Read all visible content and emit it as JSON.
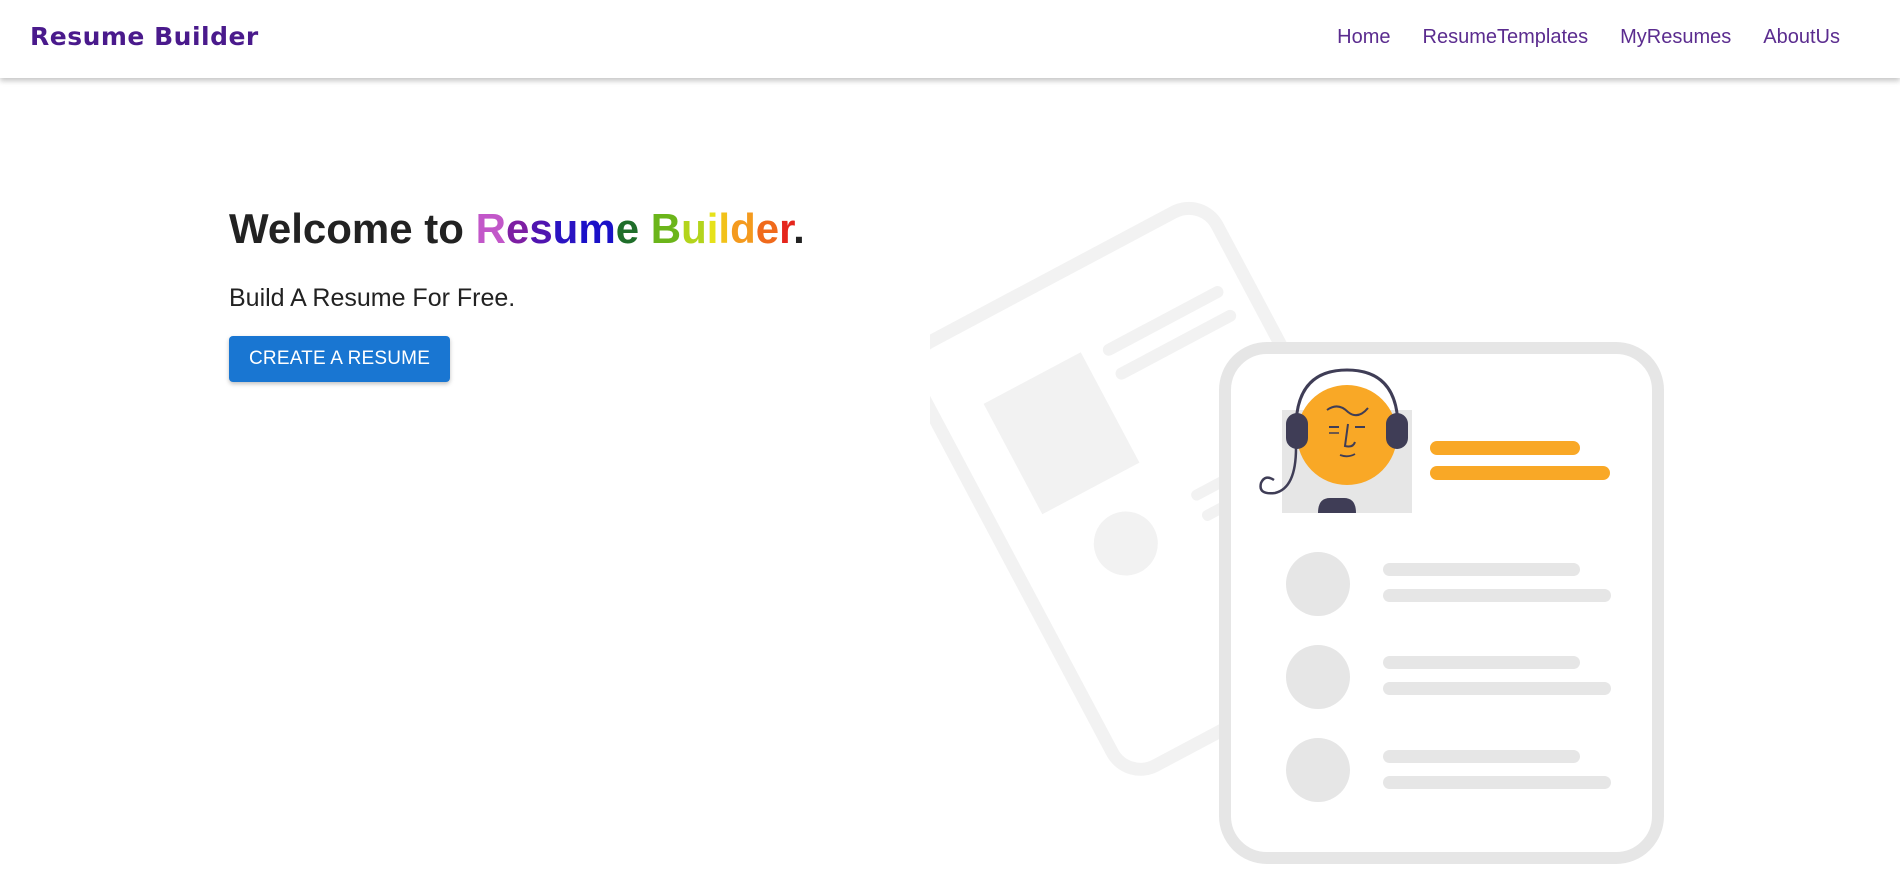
{
  "navbar": {
    "brand": "Resume Builder",
    "links": [
      {
        "label": "Home"
      },
      {
        "label": "ResumeTemplates"
      },
      {
        "label": "MyResumes"
      },
      {
        "label": "AboutUs"
      }
    ]
  },
  "hero": {
    "title_prefix": "Welcome to ",
    "title_letters": [
      {
        "char": "R",
        "color": "#c257c9"
      },
      {
        "char": "e",
        "color": "#7d1fa3"
      },
      {
        "char": "s",
        "color": "#5014b0"
      },
      {
        "char": "u",
        "color": "#2a13c2"
      },
      {
        "char": "m",
        "color": "#1a10c8"
      },
      {
        "char": "e",
        "color": "#1f6e2a"
      },
      {
        "char": " ",
        "color": "#222222"
      },
      {
        "char": "B",
        "color": "#6bb51a"
      },
      {
        "char": "u",
        "color": "#b3d41c"
      },
      {
        "char": "i",
        "color": "#e6e21a"
      },
      {
        "char": "l",
        "color": "#f2c21a"
      },
      {
        "char": "d",
        "color": "#f49a1e"
      },
      {
        "char": "e",
        "color": "#f06a1c"
      },
      {
        "char": "r",
        "color": "#e5251c"
      }
    ],
    "title_suffix": ".",
    "subtitle": "Build A Resume For Free.",
    "cta_label": "CREATE A RESUME"
  },
  "colors": {
    "brand": "#4a1a8c",
    "nav_link": "#5b2c8f",
    "cta": "#1976d2",
    "accent_orange": "#f9a826",
    "placeholder_gray": "#e6e6e6",
    "back_card_gray": "#f2f2f2",
    "dark_ink": "#3f3d56"
  }
}
